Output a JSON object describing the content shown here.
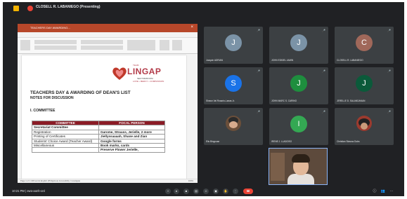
{
  "meeting": {
    "presenter_banner": "CLOSELL R. LABANIEGO (Presenting)",
    "time_code": "10:21 PM | ewo-aonh-onl"
  },
  "ppt": {
    "window_title": "TEACHERS DAY AWARDING...",
    "menu": [
      "File",
      "Home",
      "Insert",
      "Draw",
      "Design",
      "Layout",
      "References",
      "Mailings",
      "Review",
      "View",
      "Help"
    ],
    "status": "Page 1 of 1   168 words   English (Philippines)   Accessibility: Investigate",
    "zoom_label": "100%"
  },
  "document": {
    "logo_small": "TEAM",
    "logo_text": "LINGAP",
    "logo_tag1": "SECTOR/ROOM",
    "logo_tag2": "LOVE • MERCY • COMPASSION",
    "title": "TEACHERS DAY & AWARDING OF DEAN'S LIST",
    "subtitle": "NOTES FOR DISCUSSION",
    "section": "I. COMMITTEE",
    "table": {
      "headers": [
        "COMMITTEE",
        "FOCAL PERSON"
      ],
      "rows": [
        {
          "committee": "Secretariat Committee",
          "person": ""
        },
        {
          "committee": "Registration",
          "person": "Garome, Strauss, Jerielle, 2 more"
        },
        {
          "committee": "Printing of Certificates",
          "person": "Jiellyssaaaah, Shane and Zian"
        },
        {
          "committee": "Students' Choice Award (Teacher Award)",
          "person": "Google forms"
        },
        {
          "committee": "Miscellaneous",
          "person": "Book marks, cards"
        },
        {
          "committee": "",
          "person": "Preserve Flower Jerielle,"
        }
      ]
    }
  },
  "participants": [
    {
      "name": "Joaquin ADRIAN",
      "initial": "J",
      "color": "#7b93a7"
    },
    {
      "name": "JOHN EDKIEL JAMIN",
      "initial": "J",
      "color": "#7b93a7"
    },
    {
      "name": "CLOSELL R. LABANIEGO",
      "initial": "C",
      "color": "#a0685a"
    },
    {
      "name": "Shawn Val Rosario-Lanas Jr.",
      "initial": "S",
      "color": "#1a73e8"
    },
    {
      "name": "JOHN MARC S. CARINO",
      "initial": "J",
      "color": "#1e8e3e"
    },
    {
      "name": "JERELLE D. SALANDANAN",
      "initial": "J",
      "color": "#0b5a3a"
    },
    {
      "name": "Elis Bingcoan",
      "initial": "",
      "color": "#6b4f3a"
    },
    {
      "name": "IRENE J. LLADOSO",
      "initial": "I",
      "color": "#34a853"
    },
    {
      "name": "Christian Strauss Dubs",
      "initial": "",
      "color": "#9c3a2e"
    }
  ],
  "self_view": {
    "name": "You"
  },
  "controls": [
    "chevron-up",
    "mic",
    "camera",
    "captions",
    "emoji",
    "present",
    "raise-hand",
    "more",
    "end-call"
  ]
}
